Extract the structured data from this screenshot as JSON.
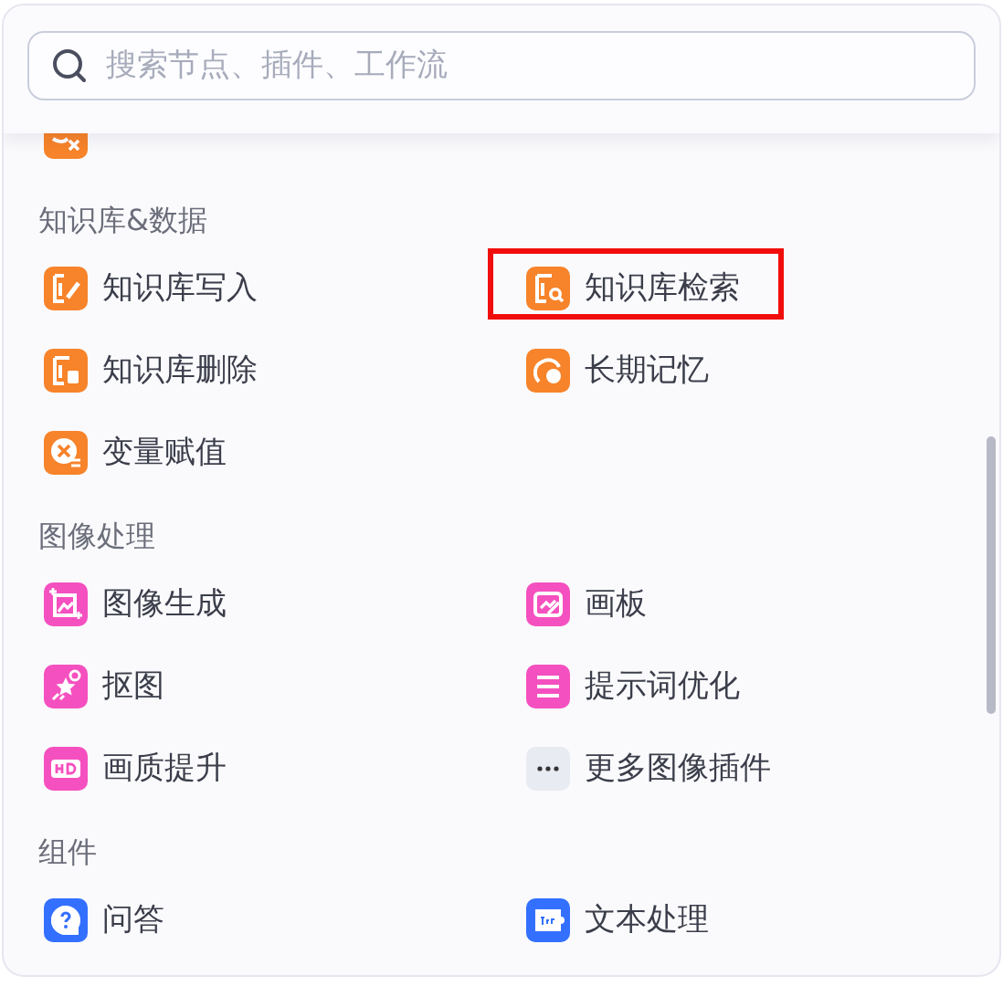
{
  "search": {
    "placeholder": "搜索节点、插件、工作流"
  },
  "sections": [
    {
      "items": [
        {
          "kind": "data-delete",
          "color": "#f7832a",
          "highlighted": false
        }
      ]
    },
    {
      "title": "知识库&数据",
      "items": [
        {
          "label": "知识库写入",
          "kind": "doc-write",
          "color": "#f7832a",
          "highlighted": false
        },
        {
          "label": "知识库检索",
          "kind": "doc-search",
          "color": "#f7832a",
          "highlighted": true
        },
        {
          "label": "知识库删除",
          "kind": "doc-delete",
          "color": "#f7832a",
          "highlighted": false
        },
        {
          "label": "长期记忆",
          "kind": "memory",
          "color": "#f7832a",
          "highlighted": false
        },
        {
          "label": "变量赋值",
          "kind": "variable",
          "color": "#f7832a",
          "highlighted": false
        }
      ]
    },
    {
      "title": "图像处理",
      "items": [
        {
          "label": "图像生成",
          "kind": "image",
          "color": "#f550bf",
          "highlighted": false
        },
        {
          "label": "画板",
          "kind": "canvas",
          "color": "#f550bf",
          "highlighted": false
        },
        {
          "label": "抠图",
          "kind": "cutout",
          "color": "#f550bf",
          "highlighted": false
        },
        {
          "label": "提示词优化",
          "kind": "sliders",
          "color": "#f550bf",
          "highlighted": false
        },
        {
          "label": "画质提升",
          "kind": "hd",
          "color": "#f550bf",
          "highlighted": false
        },
        {
          "label": "更多图像插件",
          "kind": "more",
          "color": "#e9ebf2",
          "highlighted": false
        }
      ]
    },
    {
      "title": "组件",
      "items": [
        {
          "label": "问答",
          "kind": "question",
          "color": "#3370ff",
          "highlighted": false
        },
        {
          "label": "文本处理",
          "kind": "text",
          "color": "#3370ff",
          "highlighted": false
        }
      ]
    }
  ]
}
